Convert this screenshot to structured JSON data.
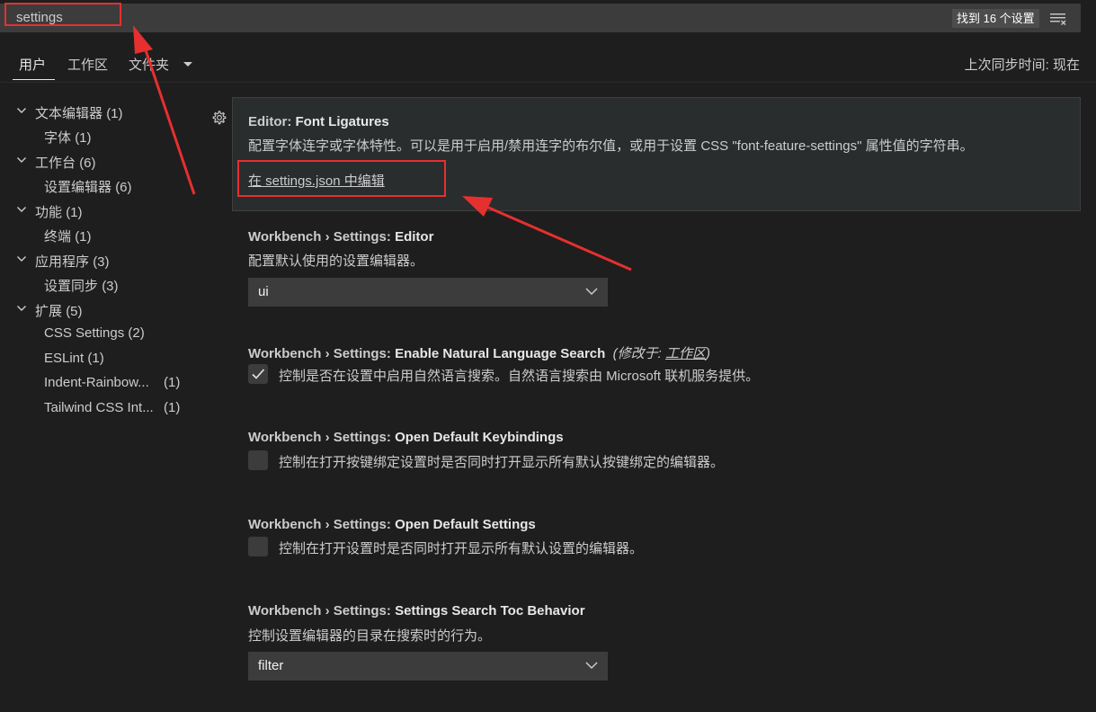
{
  "search": {
    "value": "settings",
    "result_count": "找到 16 个设置"
  },
  "tabs": [
    {
      "label": "用户"
    },
    {
      "label": "工作区"
    },
    {
      "label": "文件夹"
    }
  ],
  "sync_status": "上次同步时间: 现在",
  "toc": [
    {
      "label": "文本编辑器",
      "count": "(1)",
      "level": 0
    },
    {
      "label": "字体",
      "count": "(1)",
      "level": 1
    },
    {
      "label": "工作台",
      "count": "(6)",
      "level": 0
    },
    {
      "label": "设置编辑器",
      "count": "(6)",
      "level": 1
    },
    {
      "label": "功能",
      "count": "(1)",
      "level": 0
    },
    {
      "label": "终端",
      "count": "(1)",
      "level": 1
    },
    {
      "label": "应用程序",
      "count": "(3)",
      "level": 0
    },
    {
      "label": "设置同步",
      "count": "(3)",
      "level": 1
    },
    {
      "label": "扩展",
      "count": "(5)",
      "level": 0
    },
    {
      "label": "CSS Settings",
      "count": "(2)",
      "level": 1
    },
    {
      "label": "ESLint",
      "count": "(1)",
      "level": 1
    },
    {
      "label": "Indent-Rainbow...",
      "count": "(1)",
      "level": 1
    },
    {
      "label": "Tailwind CSS Int...",
      "count": "(1)",
      "level": 1
    }
  ],
  "settings": {
    "font_ligatures": {
      "category": "Editor: ",
      "name": "Font Ligatures",
      "description": "配置字体连字或字体特性。可以是用于启用/禁用连字的布尔值，或用于设置 CSS \"font-feature-settings\" 属性值的字符串。",
      "link": "在 settings.json 中编辑"
    },
    "settings_editor": {
      "category": "Workbench › Settings: ",
      "name": "Editor",
      "description": "配置默认使用的设置编辑器。",
      "value": "ui"
    },
    "natural_language_search": {
      "category": "Workbench › Settings: ",
      "name": "Enable Natural Language Search",
      "modified_prefix": "(修改于: ",
      "modified_scope": "工作区",
      "modified_suffix": ")",
      "description": "控制是否在设置中启用自然语言搜索。自然语言搜索由 Microsoft 联机服务提供。",
      "checked": true
    },
    "open_default_keybindings": {
      "category": "Workbench › Settings: ",
      "name": "Open Default Keybindings",
      "description": "控制在打开按键绑定设置时是否同时打开显示所有默认按键绑定的编辑器。",
      "checked": false
    },
    "open_default_settings": {
      "category": "Workbench › Settings: ",
      "name": "Open Default Settings",
      "description": "控制在打开设置时是否同时打开显示所有默认设置的编辑器。",
      "checked": false
    },
    "search_toc_behavior": {
      "category": "Workbench › Settings: ",
      "name": "Settings Search Toc Behavior",
      "description": "控制设置编辑器的目录在搜索时的行为。",
      "value": "filter"
    }
  },
  "colors": {
    "background": "#1e1e1e",
    "input_background": "#3c3c3c",
    "annotation_red": "#e5302f"
  }
}
